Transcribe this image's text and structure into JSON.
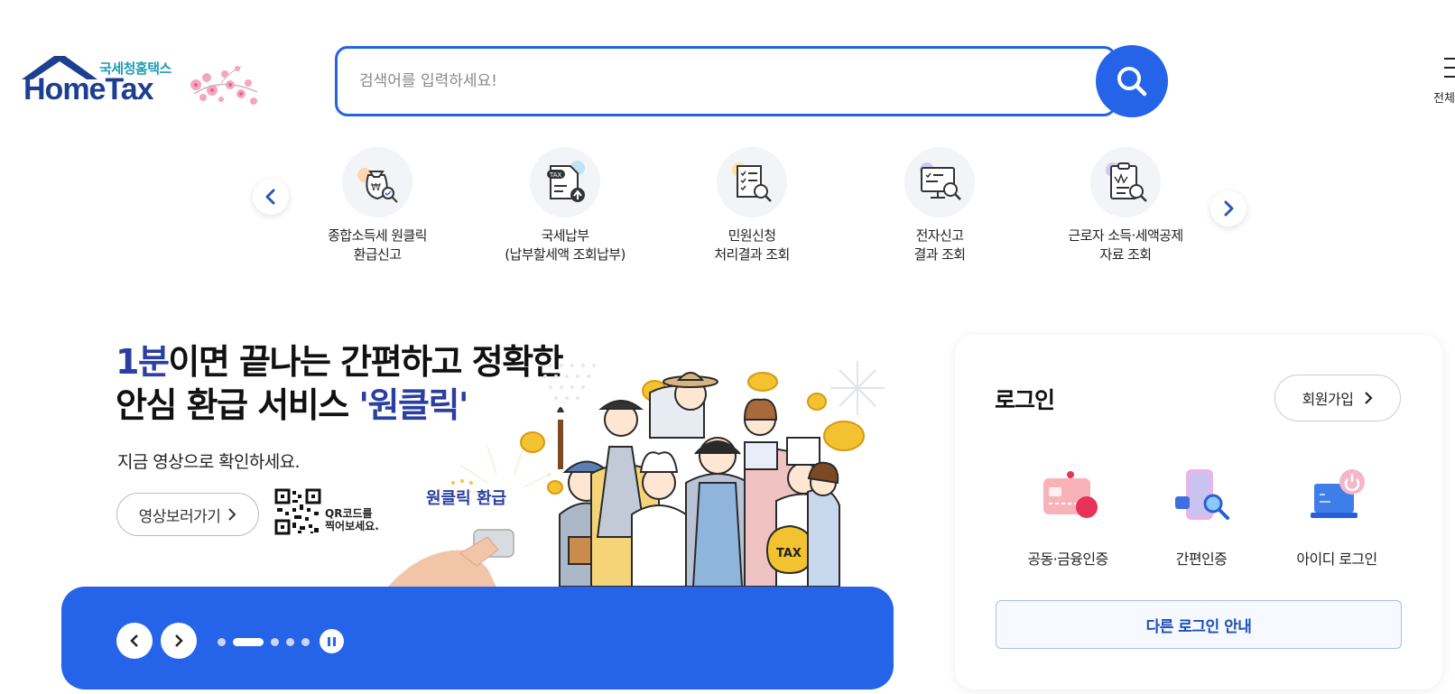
{
  "header": {
    "brand_sub": "국세청홈택스",
    "brand_main": "HomeTax",
    "search": {
      "placeholder": "검색어를 입력하세요!"
    },
    "all_menu_label": "전체메뉴"
  },
  "quick_menu": {
    "items": [
      {
        "line1": "종합소득세 원클릭",
        "line2": "환급신고",
        "icon": "money-bag-won-check-icon"
      },
      {
        "line1": "국세납부",
        "line2": "(납부할세액 조회납부)",
        "icon": "tax-document-upload-icon"
      },
      {
        "line1": "민원신청",
        "line2": "처리결과 조회",
        "icon": "checklist-search-icon"
      },
      {
        "line1": "전자신고",
        "line2": "결과 조회",
        "icon": "monitor-search-icon"
      },
      {
        "line1": "근로자 소득·세액공제",
        "line2": "자료 조회",
        "icon": "clipboard-won-search-icon"
      }
    ]
  },
  "banner": {
    "title_hl": "1분",
    "title_rest1": "이면 끝나는 간편하고 정확한",
    "title_line2_a": "안심 환급 서비스 ",
    "title_line2_hl": "'원클릭'",
    "subtitle": "지금 영상으로 확인하세요.",
    "video_button": "영상보러가기",
    "qr_line1": "QR코드를",
    "qr_line2": "찍어보세요.",
    "badge_text": "원클릭 환급",
    "tax_bag_text": "TAX",
    "slides_total": 5,
    "slide_active": 2
  },
  "login": {
    "title": "로그인",
    "join_button": "회원가입",
    "options": [
      {
        "label": "공동·금융인증",
        "icon": "certificate-card-icon"
      },
      {
        "label": "간편인증",
        "icon": "phone-search-icon"
      },
      {
        "label": "아이디 로그인",
        "icon": "laptop-power-icon"
      }
    ],
    "other_login": "다른 로그인 안내"
  },
  "colors": {
    "primary": "#2564e8",
    "navy": "#2b3fa0",
    "brand_teal": "#1d9bb8"
  }
}
